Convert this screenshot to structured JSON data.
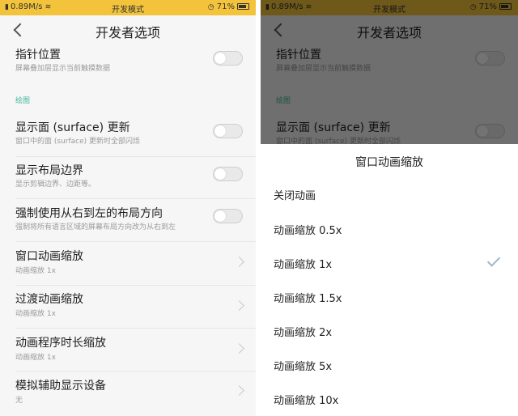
{
  "status_bar": {
    "speed": "0.89M/s",
    "mode": "开发模式",
    "battery": "71%"
  },
  "nav": {
    "title": "开发者选项"
  },
  "settings": {
    "pointer_location": {
      "title": "指针位置",
      "subtitle": "屏幕叠加层显示当前触摸数据"
    },
    "section_drawing": "绘图",
    "show_surface_updates": {
      "title": "显示面 (surface) 更新",
      "subtitle": "窗口中的面 (surface) 更新时全部闪烁"
    },
    "show_layout_bounds": {
      "title": "显示布局边界",
      "subtitle": "显示剪辑边界、边距等。"
    },
    "force_rtl": {
      "title": "强制使用从右到左的布局方向",
      "subtitle": "强制将所有语言区域的屏幕布局方向改为从右到左"
    },
    "window_animation_scale": {
      "title": "窗口动画缩放",
      "value": "动画缩放 1x"
    },
    "transition_animation_scale": {
      "title": "过渡动画缩放",
      "value": "动画缩放 1x"
    },
    "animator_duration_scale": {
      "title": "动画程序时长缩放",
      "value": "动画缩放 1x"
    },
    "simulate_display": {
      "title": "模拟辅助显示设备",
      "value": "无"
    }
  },
  "dialog": {
    "title": "窗口动画缩放",
    "options": [
      {
        "label": "关闭动画",
        "selected": false
      },
      {
        "label": "动画缩放 0.5x",
        "selected": false
      },
      {
        "label": "动画缩放 1x",
        "selected": true
      },
      {
        "label": "动画缩放 1.5x",
        "selected": false
      },
      {
        "label": "动画缩放 2x",
        "selected": false
      },
      {
        "label": "动画缩放 5x",
        "selected": false
      },
      {
        "label": "动画缩放 10x",
        "selected": false
      }
    ]
  },
  "colors": {
    "status_bar": "#f3c43b",
    "section_header": "#3fb99e",
    "check": "#9fb6c9"
  }
}
